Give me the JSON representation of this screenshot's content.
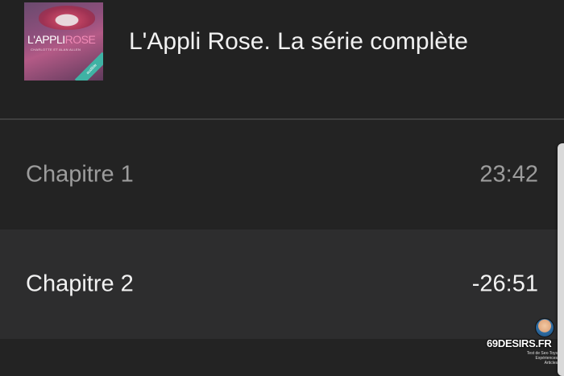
{
  "header": {
    "title": "L'Appli Rose. La série complète",
    "cover": {
      "title_part1": "L'APPLI",
      "title_part2": "ROSE",
      "subtitle": "CHARLOTTE ET ALAN ALLEN",
      "ribbon": "audible"
    }
  },
  "chapters": [
    {
      "label": "Chapitre 1",
      "time": "23:42",
      "state": "played"
    },
    {
      "label": "Chapitre 2",
      "time": "-26:51",
      "state": "current"
    }
  ],
  "watermark": {
    "site": "69DESIRS.FR",
    "line1": "Test de Sex-Toys",
    "line2": "Expériences",
    "line3": "Articles"
  },
  "colors": {
    "background": "#232323",
    "selected_row": "#2d2d2e",
    "played_text": "#9c9c9c",
    "active_text": "#f2f2f2",
    "rose_accent": "#f08ab6"
  }
}
